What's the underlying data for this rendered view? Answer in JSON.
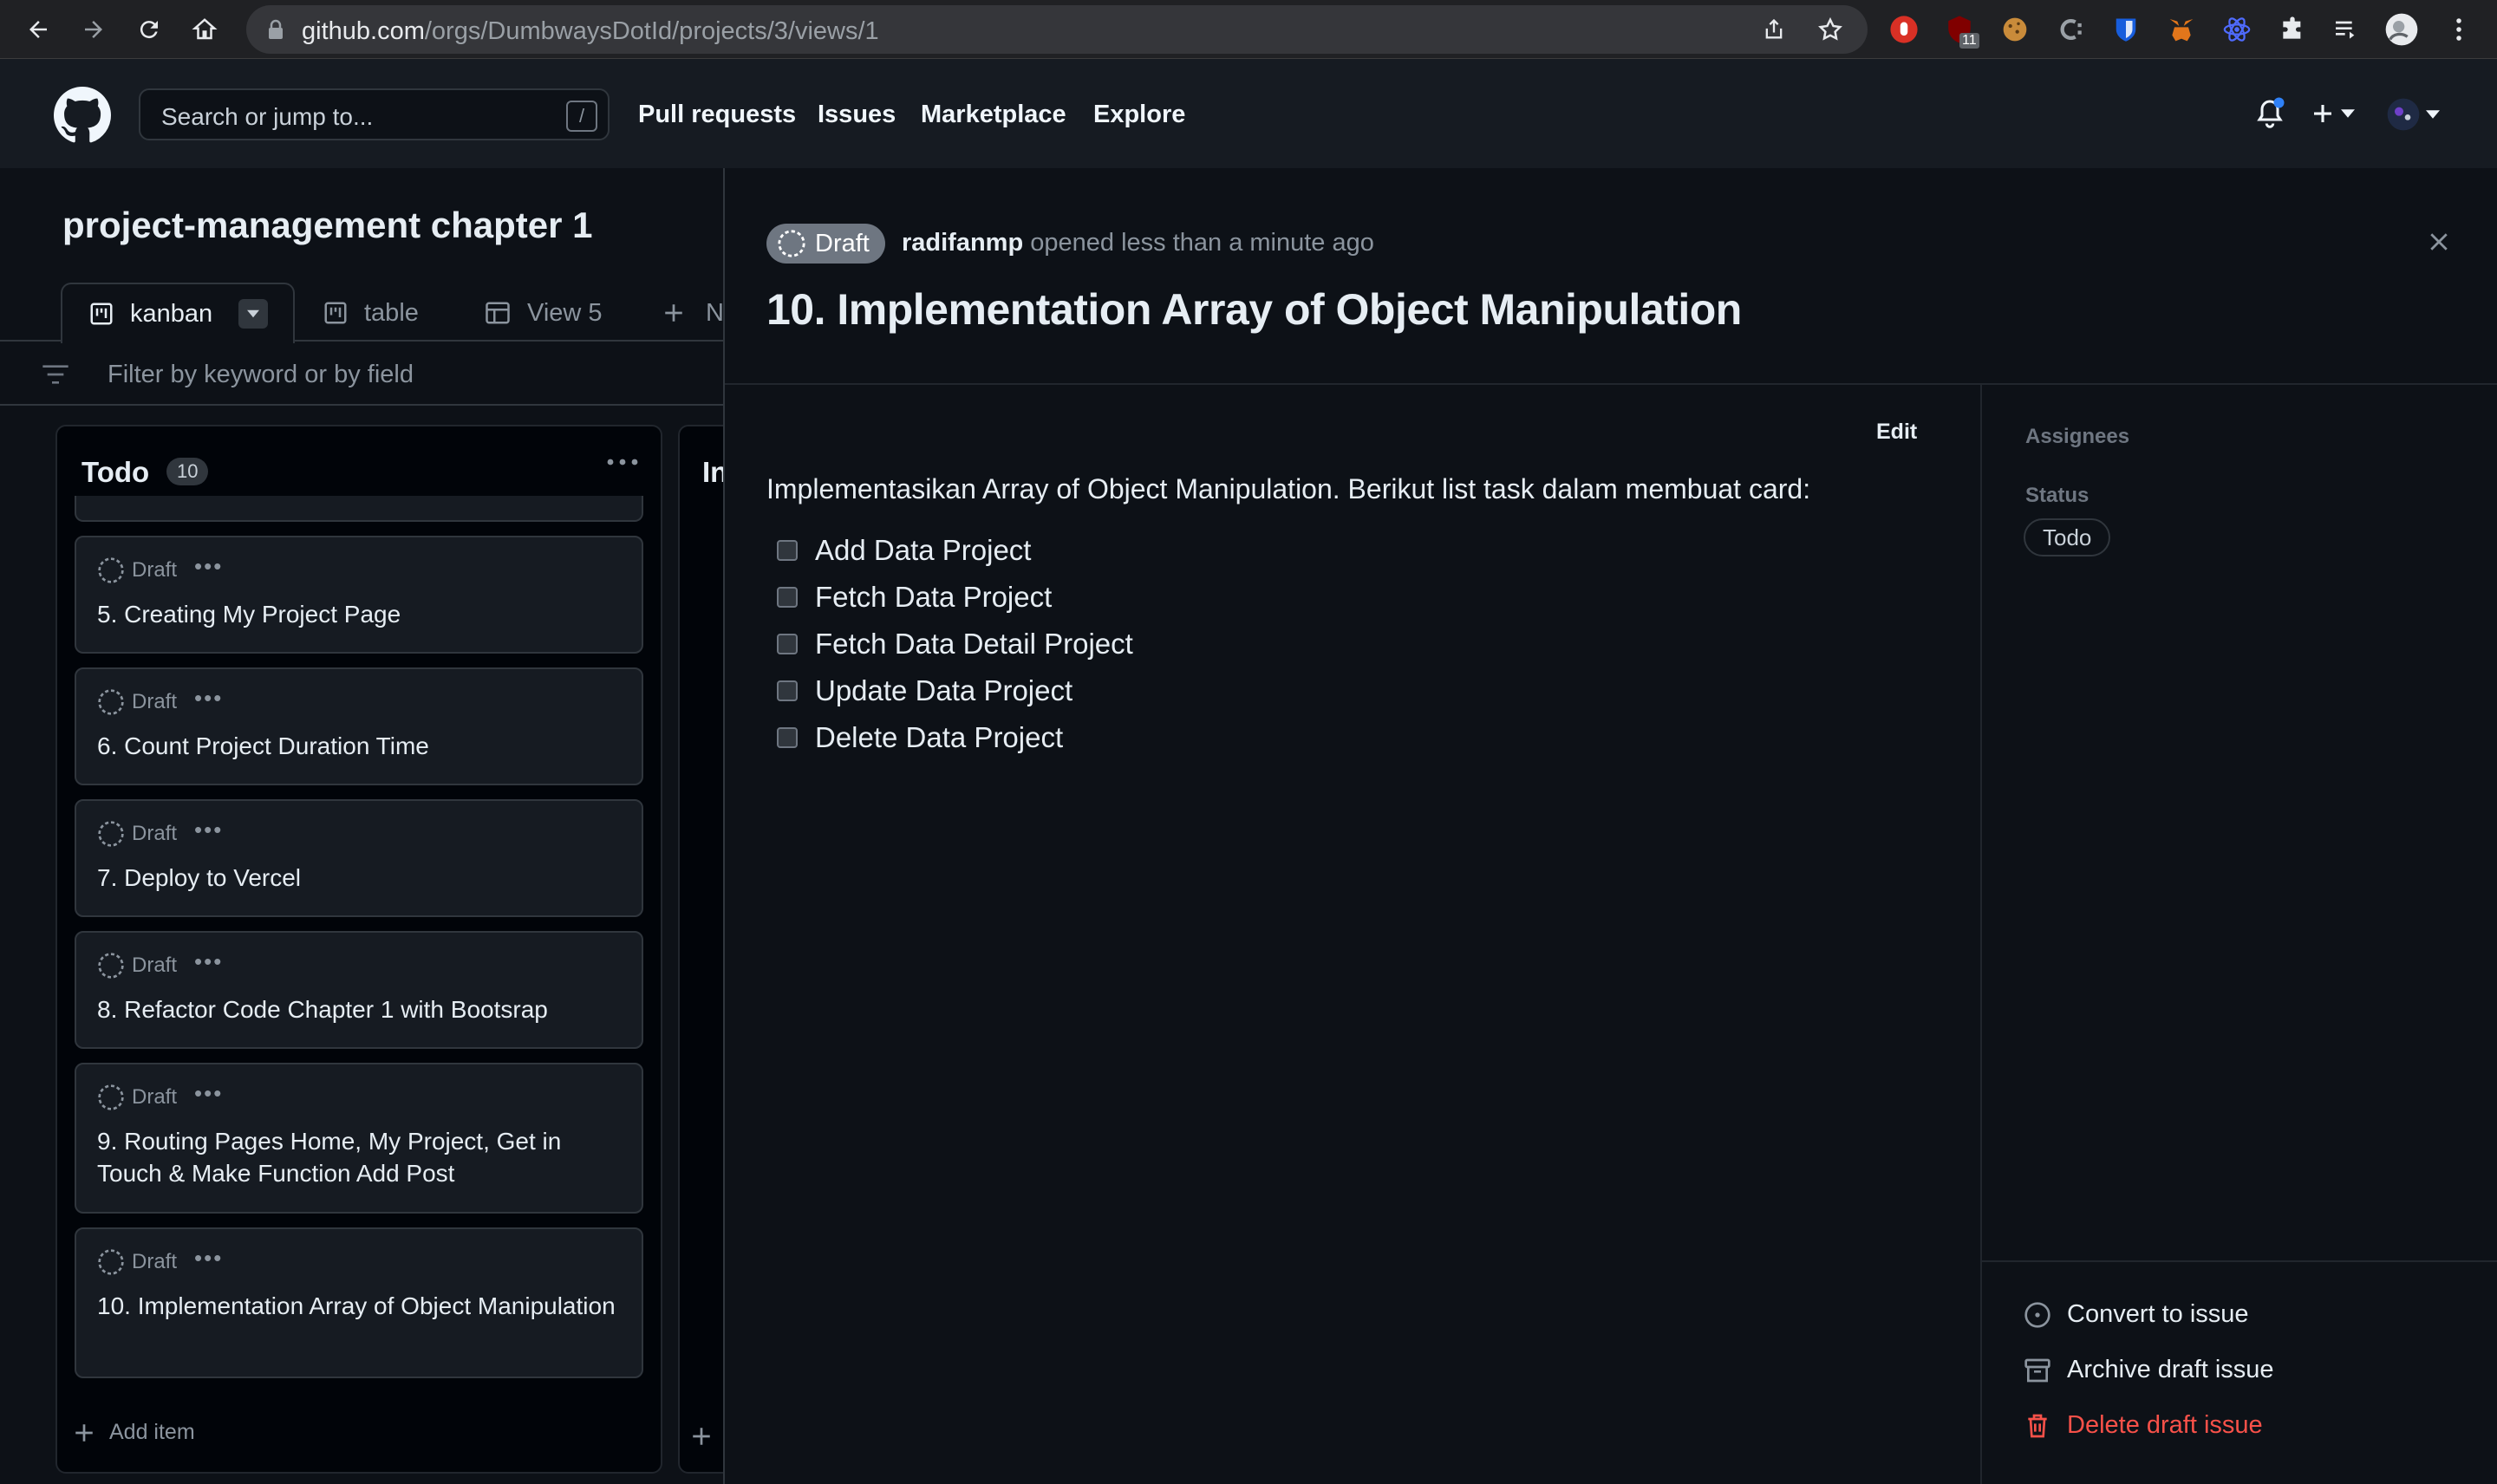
{
  "browser": {
    "url_host": "github.com",
    "url_path": "/orgs/DumbwaysDotId/projects/3/views/1",
    "ublock_count": "11"
  },
  "header": {
    "search_placeholder": "Search or jump to...",
    "search_shortcut": "/",
    "nav": [
      "Pull requests",
      "Issues",
      "Marketplace",
      "Explore"
    ]
  },
  "project": {
    "title": "project-management chapter 1",
    "views": [
      {
        "label": "kanban",
        "active": true
      },
      {
        "label": "table",
        "active": false
      },
      {
        "label": "View 5",
        "active": false
      },
      {
        "label": "N",
        "active": false
      }
    ],
    "filter_placeholder": "Filter by keyword or by field",
    "columns": [
      {
        "title": "Todo",
        "count": "10",
        "cards": [
          {
            "status": "Draft",
            "title": "5. Creating My Project Page"
          },
          {
            "status": "Draft",
            "title": "6. Count Project Duration Time"
          },
          {
            "status": "Draft",
            "title": "7. Deploy to Vercel"
          },
          {
            "status": "Draft",
            "title": "8. Refactor Code Chapter 1 with Bootsrap"
          },
          {
            "status": "Draft",
            "title": "9. Routing Pages Home, My Project, Get in Touch & Make Function Add Post"
          },
          {
            "status": "Draft",
            "title": "10. Implementation Array of Object Manipulation"
          }
        ],
        "add_item": "Add item"
      },
      {
        "title": "In"
      }
    ]
  },
  "detail": {
    "badge": "Draft",
    "author": "radifanmp",
    "opened_text": "opened less than a minute ago",
    "title": "10. Implementation Array of Object Manipulation",
    "edit_label": "Edit",
    "description": "Implementasikan Array of Object Manipulation. Berikut list task dalam membuat card:",
    "tasks": [
      {
        "label": "Add Data Project",
        "checked": false
      },
      {
        "label": "Fetch Data Project",
        "checked": false
      },
      {
        "label": "Fetch Data Detail Project",
        "checked": false
      },
      {
        "label": "Update Data Project",
        "checked": false
      },
      {
        "label": "Delete Data Project",
        "checked": false
      }
    ],
    "sidebar": {
      "assignees_label": "Assignees",
      "status_label": "Status",
      "status_value": "Todo",
      "actions": [
        "Convert to issue",
        "Archive draft issue",
        "Delete draft issue"
      ]
    }
  },
  "colors": {
    "background": "#0d1117",
    "header": "#161b22",
    "danger": "#f85149",
    "notification_dot": "#2f81f7"
  }
}
